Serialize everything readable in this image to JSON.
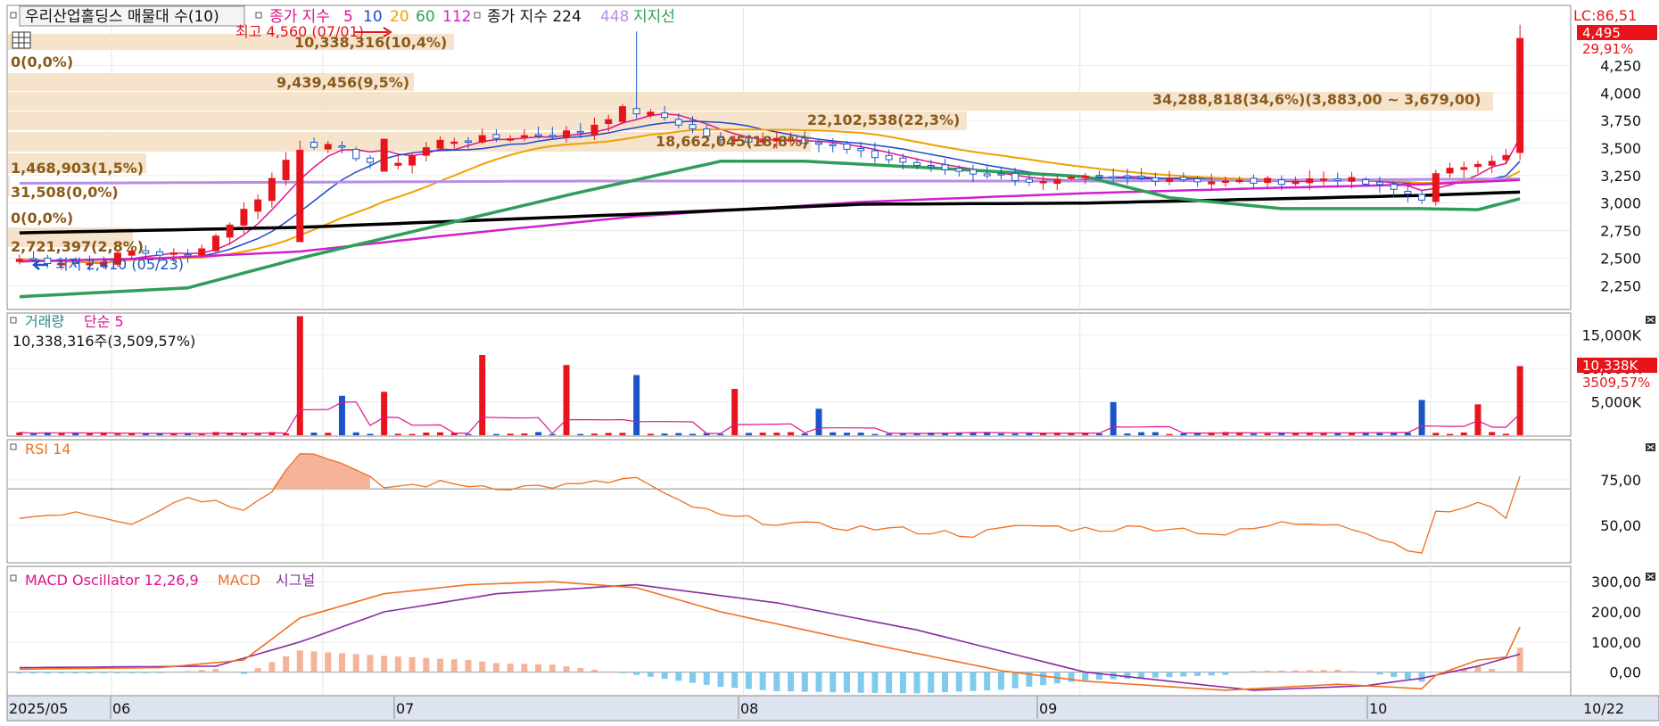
{
  "header": {
    "title": "우리산업홀딩스 매물대 수(10)",
    "ma_label": "종가 지수",
    "ma_periods": [
      "5",
      "10",
      "20",
      "60",
      "112"
    ],
    "ma_long_label": "종가 지수 224",
    "ma_long2": "448",
    "support_label": "지지선"
  },
  "colors": {
    "up": "#e8141c",
    "down": "#1a55c8",
    "ma5": "#e0138c",
    "ma10": "#2048c8",
    "ma20": "#f0a000",
    "ma60": "#2e9e58",
    "ma112": "#d020d0",
    "ma224": "#000000",
    "ma448": "#b88ee8",
    "support": "#2e9e58",
    "vp": "#f5e3cc",
    "vp_text": "#8a5a1a",
    "rsi": "#f07020",
    "macd": "#f07020",
    "signal": "#8a2aa0",
    "osc_pos": "#f5b49a",
    "osc_neg": "#7ecbef"
  },
  "right_badges": {
    "lc": "LC:86,51",
    "price": "4,495",
    "pct": "29,91%",
    "vol": "10,338K",
    "vol_pct": "3509,57%"
  },
  "annotations": {
    "high": "최고 4,560 (07/01)",
    "low": "최저 2,410 (05/23)"
  },
  "volume_profile": [
    {
      "text": "10,338,316(10,4%)"
    },
    {
      "text": "0(0,0%)"
    },
    {
      "text": "9,439,456(9,5%)"
    },
    {
      "text": "34,288,818(34,6%)(3,883,00 ~ 3,679,00)"
    },
    {
      "text": "22,102,538(22,3%)"
    },
    {
      "text": "18,662,045(18,8%)"
    },
    {
      "text": "1,468,903(1,5%)"
    },
    {
      "text": "31,508(0,0%)"
    },
    {
      "text": "0(0,0%)"
    },
    {
      "text": "2,721,397(2,8%)"
    }
  ],
  "panels": {
    "volume": {
      "title": "거래량",
      "ma_label": "단순 5",
      "info": "10,338,316주(3,509,57%)"
    },
    "rsi": {
      "title": "RSI 14"
    },
    "macd": {
      "title": "MACD Oscillator 12,26,9",
      "macd_label": "MACD",
      "signal_label": "시그널"
    }
  },
  "chart_data": [
    {
      "type": "candlestick",
      "title": "우리산업홀딩스 매물대 수(10)",
      "y_ticks": [
        "2,250",
        "2,500",
        "2,750",
        "3,000",
        "3,250",
        "3,500",
        "3,750",
        "4,000",
        "4,250"
      ],
      "y_tick_values": [
        2250,
        2500,
        2750,
        3000,
        3250,
        3500,
        3750,
        4000,
        4250
      ],
      "ylim": [
        2050,
        4780
      ],
      "x_labels": [
        "2025/05",
        "06",
        "07",
        "08",
        "09",
        "10",
        "10/22"
      ],
      "grid": true,
      "last_close": 4495,
      "change_pct": 29.91,
      "high": 4560,
      "low": 2410
    },
    {
      "type": "bar",
      "title": "거래량",
      "y_ticks": [
        "5,000K",
        "10,000K",
        "15,000K"
      ],
      "y_tick_values": [
        5000,
        10000,
        15000
      ],
      "ylim": [
        0,
        18000
      ],
      "last_value_k": 10338
    },
    {
      "type": "line",
      "title": "RSI 14",
      "y_ticks": [
        "50,00",
        "75,00"
      ],
      "y_tick_values": [
        50,
        75
      ],
      "ylim": [
        30,
        96
      ],
      "reference_level": 70,
      "last_value": 77
    },
    {
      "type": "line",
      "title": "MACD Oscillator 12,26,9",
      "y_ticks": [
        "0,00",
        "100,00",
        "200,00",
        "300,00"
      ],
      "y_tick_values": [
        0,
        100,
        200,
        300
      ],
      "ylim": [
        -75,
        345
      ]
    }
  ]
}
